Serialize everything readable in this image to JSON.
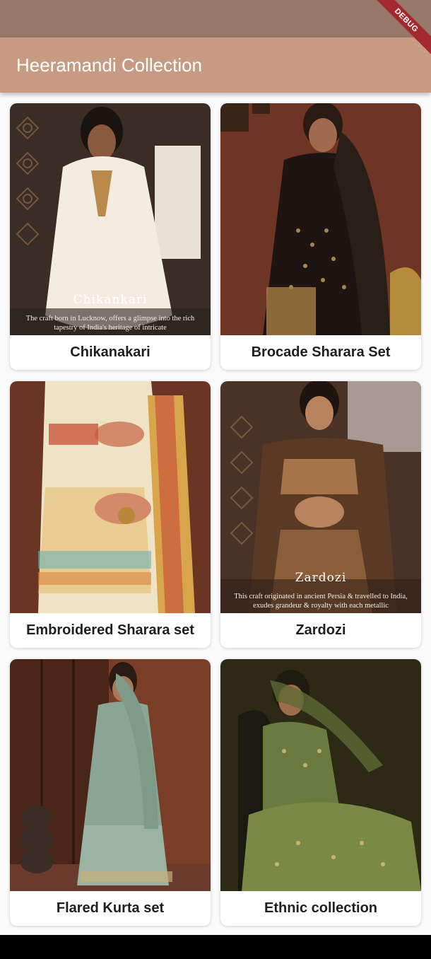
{
  "app_bar": {
    "title": "Heeramandi Collection"
  },
  "debug_banner": "DEBUG",
  "colors": {
    "status_bar": "#97796a",
    "app_bar": "#c79b82",
    "debug_banner": "#a4292e"
  },
  "cards": [
    {
      "label": "Chikanakari",
      "image_overlay_title": "Chikankari",
      "image_overlay_caption": "The craft born in Lucknow, offers a glimpse into the rich tapestry of India's heritage of intricate"
    },
    {
      "label": "Brocade Sharara Set"
    },
    {
      "label": "Embroidered Sharara set"
    },
    {
      "label": "Zardozi",
      "image_overlay_title": "Zardozi",
      "image_overlay_caption": "This craft originated in ancient Persia & travelled to India, exudes grandeur & royalty with each metallic"
    },
    {
      "label": "Flared Kurta set"
    },
    {
      "label": "Ethnic collection"
    }
  ]
}
